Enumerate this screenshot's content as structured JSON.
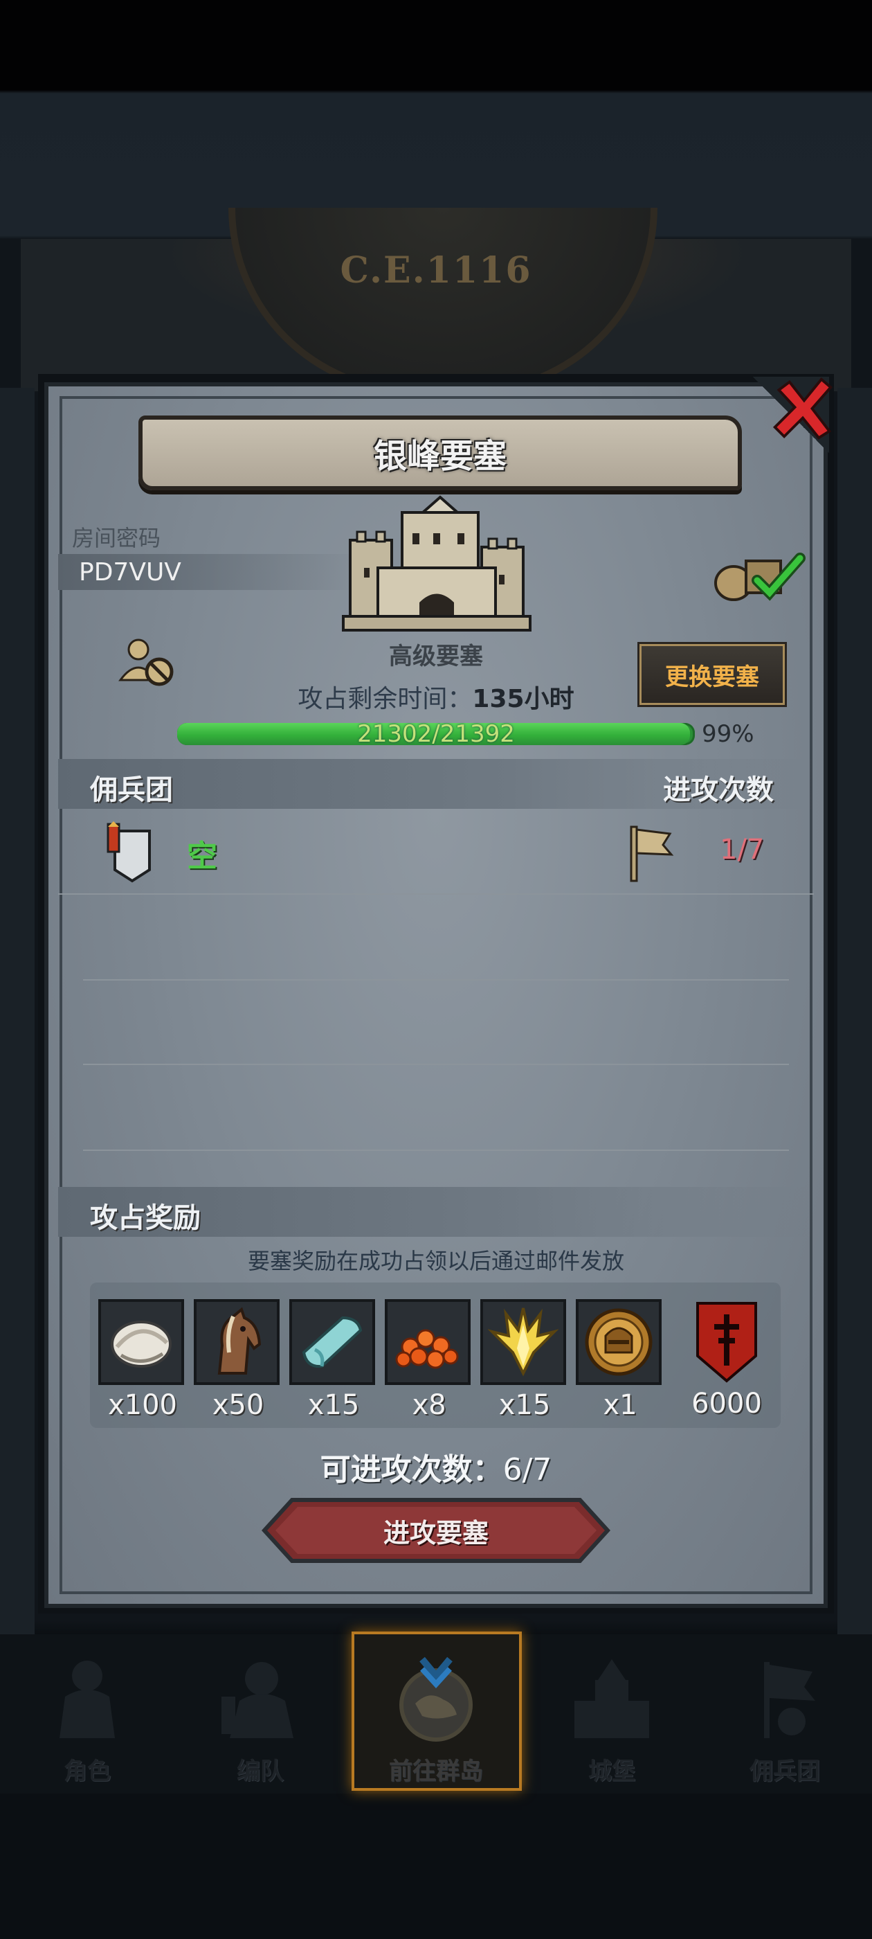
{
  "era": "C.E.1116",
  "fortress": {
    "title": "银峰要塞",
    "room_label": "房间密码",
    "room_code": "PD7VUV",
    "type": "高级要塞",
    "change_button": "更换要塞",
    "time_label": "攻占剩余时间：",
    "time_value": "135小时",
    "hp_text": "21302/21392",
    "hp_fraction": 0.99,
    "hp_percent": "99%"
  },
  "mercenary": {
    "title": "佣兵团",
    "attack_header": "进攻次数",
    "rows": [
      {
        "name": "空",
        "attacks": "1/7"
      }
    ]
  },
  "rewards": {
    "title": "攻占奖励",
    "note": "要塞奖励在成功占领以后通过邮件发放",
    "items": [
      {
        "icon": "oyster-icon",
        "qty": "x100"
      },
      {
        "icon": "horse-icon",
        "qty": "x50"
      },
      {
        "icon": "cloth-icon",
        "qty": "x15"
      },
      {
        "icon": "caviar-icon",
        "qty": "x8"
      },
      {
        "icon": "gold-crest-icon",
        "qty": "x15"
      },
      {
        "icon": "knight-medal-icon",
        "qty": "x1"
      }
    ],
    "banner": {
      "icon": "guild-banner-icon",
      "qty": "6000"
    }
  },
  "available": {
    "label": "可进攻次数：",
    "value": "6/7"
  },
  "attack_button": "进攻要塞",
  "nav": [
    {
      "label": "角色",
      "icon": "character-icon"
    },
    {
      "label": "编队",
      "icon": "formation-icon"
    },
    {
      "label": "前往群岛",
      "icon": "islands-icon",
      "active": true
    },
    {
      "label": "城堡",
      "icon": "castle-icon"
    },
    {
      "label": "佣兵团",
      "icon": "mercenary-icon"
    }
  ],
  "colors": {
    "accent_gold": "#f2b24a",
    "hp_green": "#33b03a",
    "attack_red": "#e0707a",
    "empty_green": "#4fc94a",
    "close_red": "#d8272a"
  }
}
